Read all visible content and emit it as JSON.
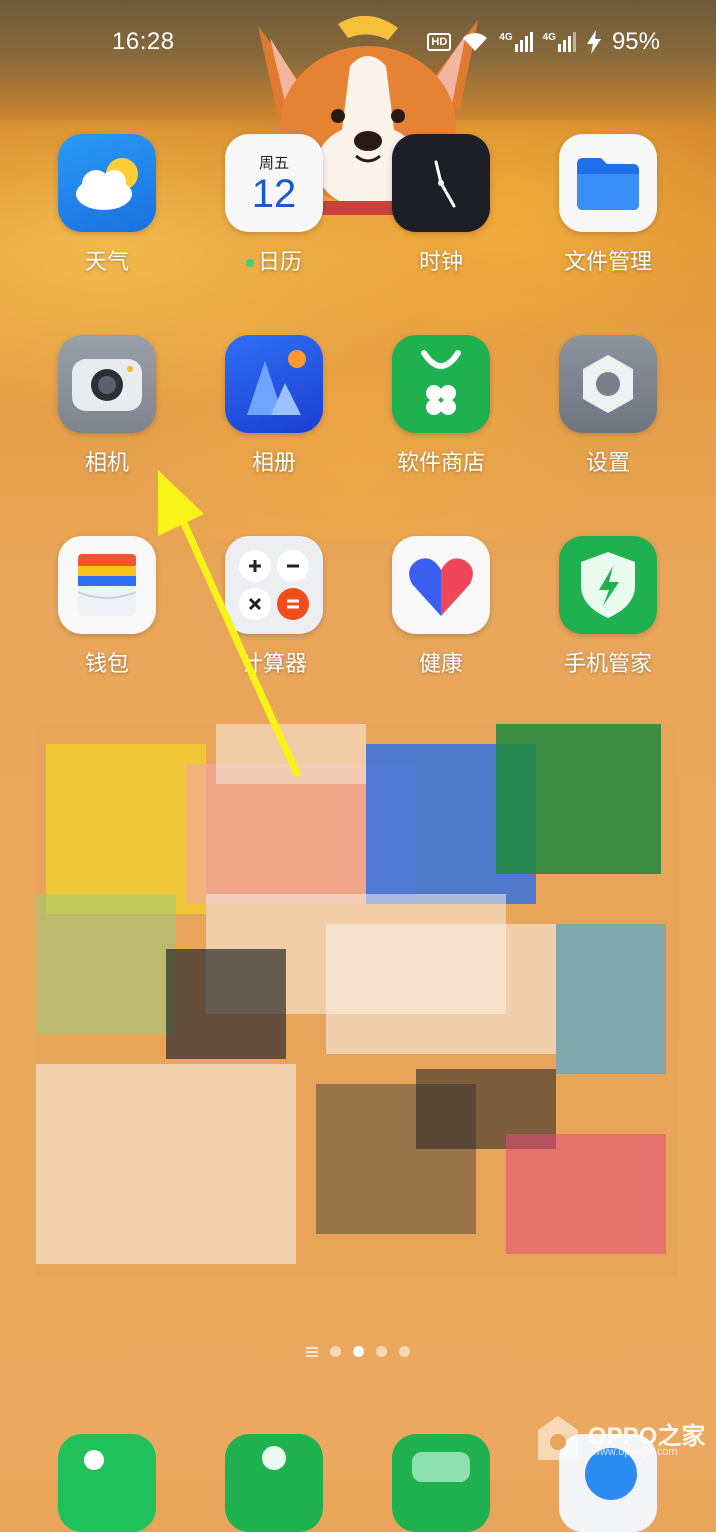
{
  "status_bar": {
    "time": "16:28",
    "hd_badge": "HD",
    "network_1": "4G",
    "network_2": "4G",
    "battery": "95%"
  },
  "apps": [
    {
      "label": "天气",
      "icon": "weather-icon"
    },
    {
      "label": "日历",
      "icon": "calendar-icon",
      "weekday": "周五",
      "day": "12"
    },
    {
      "label": "时钟",
      "icon": "clock-icon"
    },
    {
      "label": "文件管理",
      "icon": "folder-icon"
    },
    {
      "label": "相机",
      "icon": "camera-icon"
    },
    {
      "label": "相册",
      "icon": "gallery-icon"
    },
    {
      "label": "软件商店",
      "icon": "app-store-icon"
    },
    {
      "label": "设置",
      "icon": "settings-gear-icon"
    },
    {
      "label": "钱包",
      "icon": "wallet-icon"
    },
    {
      "label": "计算器",
      "icon": "calculator-icon"
    },
    {
      "label": "健康",
      "icon": "health-heart-icon"
    },
    {
      "label": "手机管家",
      "icon": "phone-manager-shield-icon"
    }
  ],
  "pager": {
    "active_index": 1,
    "count": 4
  },
  "dock": [
    {
      "icon": "phone-icon"
    },
    {
      "icon": "contacts-icon"
    },
    {
      "icon": "messages-icon"
    },
    {
      "icon": "browser-icon"
    }
  ],
  "watermark": {
    "text": "OPPO之家",
    "url": "www.oppojia.com"
  },
  "colors": {
    "background": "#e8a55a",
    "annotation_arrow": "#f7f316"
  }
}
